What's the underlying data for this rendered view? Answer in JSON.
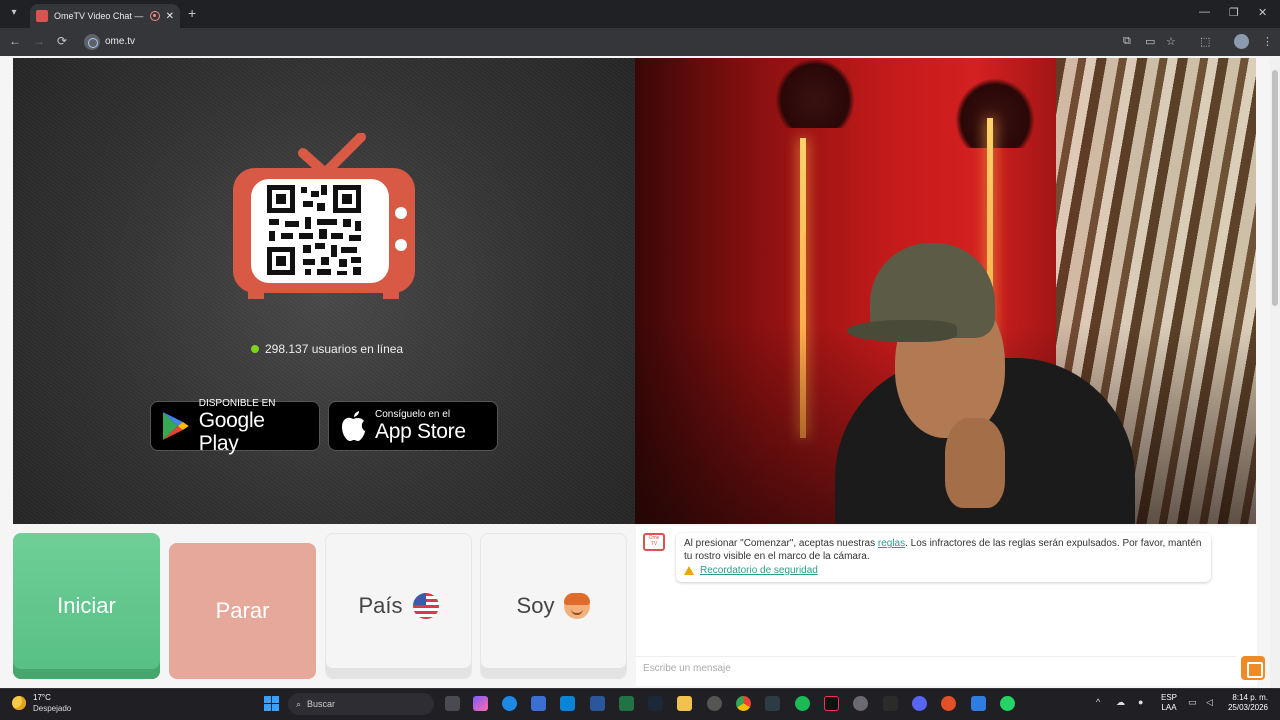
{
  "browser": {
    "tab_title": "OmeTV Video Chat — Omegle",
    "tab_close": "✕",
    "new_tab": "+",
    "window_controls": {
      "minimize": "—",
      "restore": "❐",
      "close": "✕"
    },
    "nav": {
      "back": "←",
      "forward": "→",
      "reload": "⟳"
    },
    "url": "ome.tv"
  },
  "left_panel": {
    "online_count_text": "298.137 usuarios en línea",
    "google_play": {
      "small": "DISPONIBLE EN",
      "big": "Google Play"
    },
    "app_store": {
      "small": "Consíguelo en el",
      "big": "App Store"
    }
  },
  "controls": {
    "start_label": "Iniciar",
    "stop_label": "Parar",
    "country_label": "País",
    "gender_label": "Soy",
    "country_flag": "us-flag-icon",
    "gender_icon": "boy-emoji-icon"
  },
  "chat": {
    "logo_text": "Ome TV",
    "notice_before_link": "Al presionar \"Comenzar\", aceptas nuestras ",
    "notice_link": "reglas",
    "notice_after_link": ". Los infractores de las reglas serán expulsados. Por favor, mantén tu rostro visible en el marco de la cámara.",
    "safety_link": "Recordatorio de seguridad",
    "input_placeholder": "Escribe un mensaje"
  },
  "taskbar": {
    "weather_temp": "17°C",
    "weather_desc": "Despejado",
    "search_placeholder": "Buscar",
    "lang_top": "ESP",
    "lang_bottom": "LAA",
    "time": "8:14 p. m.",
    "date": "25/03/2026"
  },
  "colors": {
    "start_green": "#6fcf97",
    "stop_salmon": "#e6a89b",
    "brand_red": "#d9534f",
    "online_green": "#7ed321",
    "link_teal": "#2a9d8f"
  }
}
